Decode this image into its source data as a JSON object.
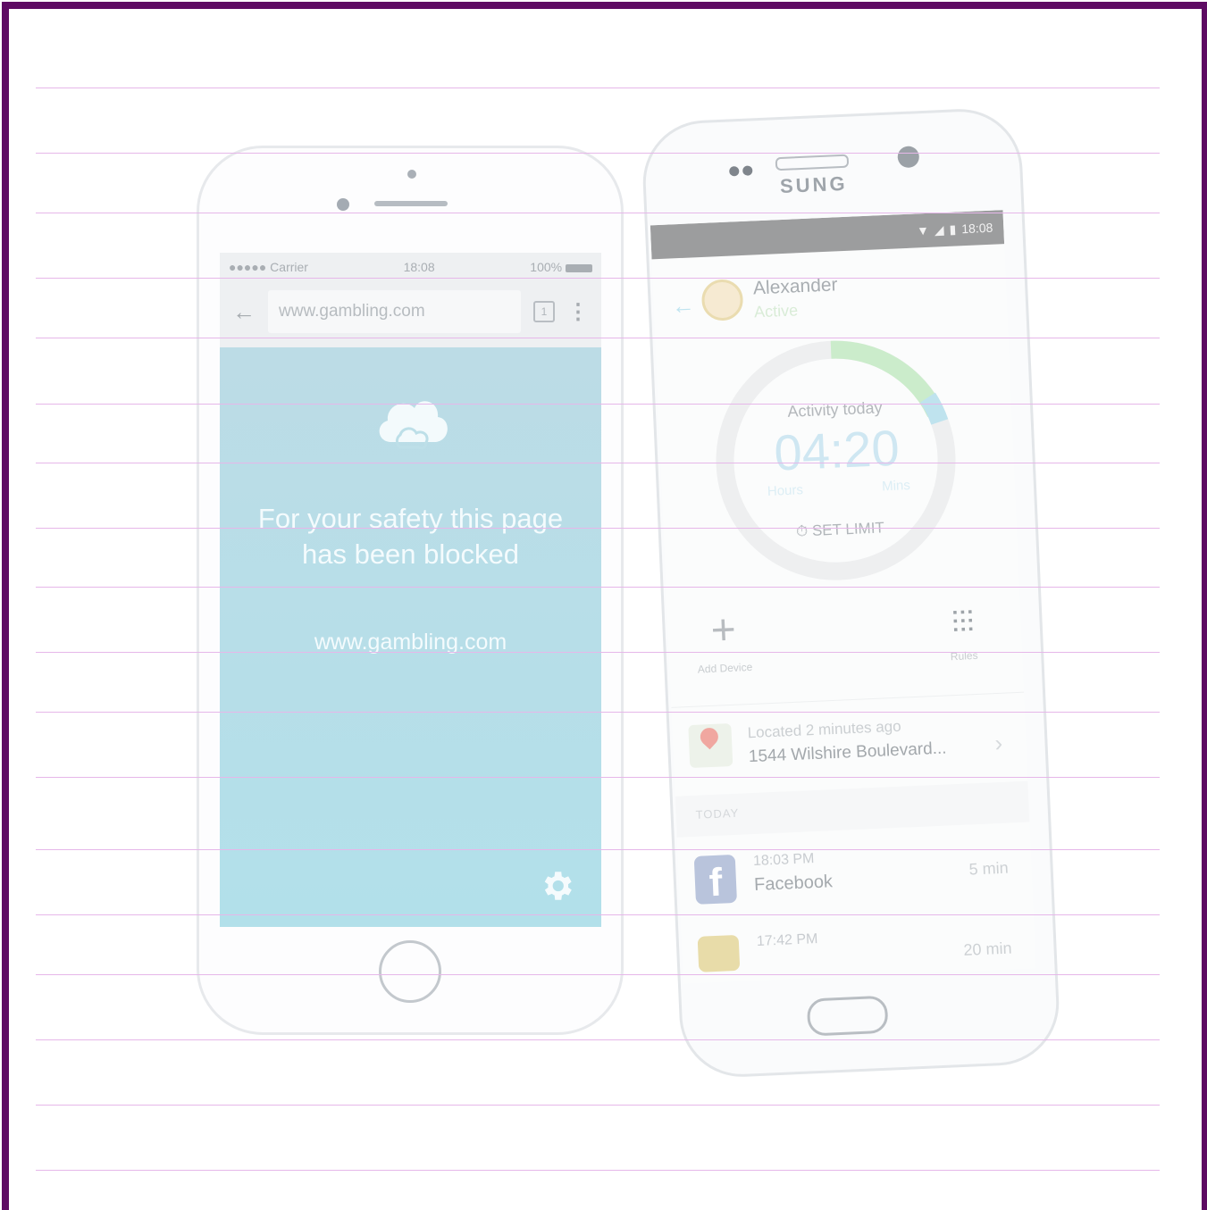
{
  "iphone": {
    "status": {
      "carrier": "●●●●● Carrier",
      "time": "18:08",
      "battery": "100%"
    },
    "browser": {
      "url": "www.gambling.com",
      "tab_count": "1"
    },
    "blocked": {
      "message": "For your safety this page has been blocked",
      "url": "www.gambling.com",
      "background_color": "#b4dfe9"
    }
  },
  "samsung": {
    "brand": "SUNG",
    "status_time": "18:08",
    "profile": {
      "name": "Alexander",
      "state": "Active"
    },
    "activity": {
      "label": "Activity today",
      "time": "04:20",
      "hours_label": "Hours",
      "mins_label": "Mins",
      "set_limit": "SET LIMIT"
    },
    "actions": {
      "add_device": "Add Device",
      "rules": "Rules"
    },
    "location": {
      "subtitle": "Located 2 minutes ago",
      "address": "1544 Wilshire Boulevard..."
    },
    "today_label": "TODAY",
    "history": [
      {
        "time": "18:03 PM",
        "app": "Facebook",
        "duration": "5 min"
      },
      {
        "time": "17:42 PM",
        "app": "",
        "duration": "20 min"
      }
    ]
  },
  "colors": {
    "frame": "#5e0b63",
    "rules": "#e6b7e9",
    "accent_blue": "#8fd0e6",
    "ring_green": "#b7e4b7"
  }
}
